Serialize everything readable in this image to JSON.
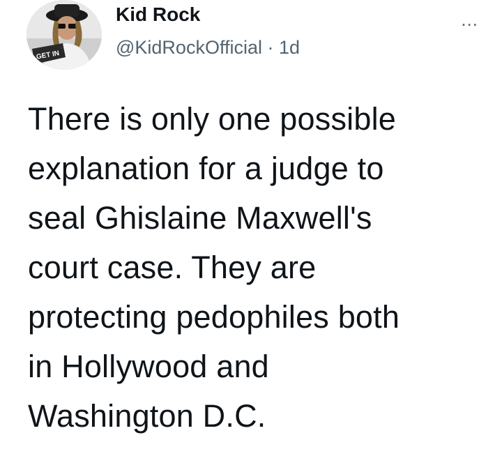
{
  "author": {
    "display_name": "Kid Rock",
    "handle": "@KidRockOfficial",
    "separator": "·",
    "timestamp": "1d",
    "avatar_caption": "GET IN"
  },
  "actions": {
    "more_icon": "more-dots-icon",
    "more_label": "..."
  },
  "tweet": {
    "lines": [
      "There is only one possible",
      "explanation for a judge to",
      "seal Ghislaine Maxwell's",
      "court case. They are",
      "protecting pedophiles both",
      "in Hollywood and",
      "Washington D.C."
    ]
  },
  "colors": {
    "text_primary": "#0f1419",
    "text_secondary": "#536471",
    "background": "#ffffff"
  }
}
